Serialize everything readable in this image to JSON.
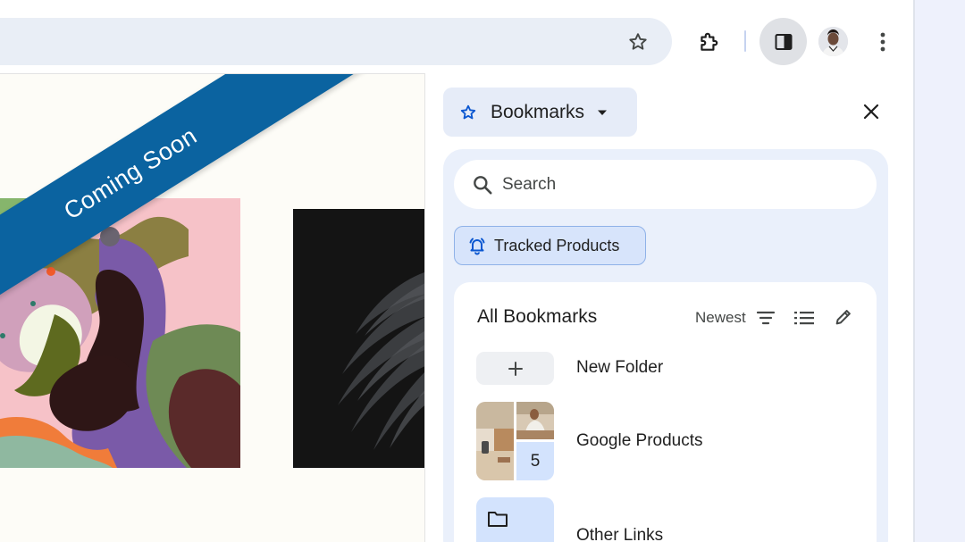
{
  "banner": {
    "text": "Coming Soon"
  },
  "toolbar": {
    "bookmark_star_icon": "star-outline-icon",
    "extensions_icon": "puzzle-icon",
    "side_panel_icon": "side-panel-icon",
    "menu_icon": "three-dots-vertical-icon"
  },
  "side_panel": {
    "header_title": "Bookmarks",
    "search": {
      "placeholder": "Search",
      "value": ""
    },
    "chip": {
      "label": "Tracked Products",
      "icon": "bell-ring-icon"
    },
    "section": {
      "title": "All Bookmarks",
      "sort_label": "Newest"
    },
    "items": [
      {
        "label": "New Folder",
        "type": "action"
      },
      {
        "label": "Google Products",
        "type": "folder",
        "count": "5"
      },
      {
        "label": "Other Links",
        "type": "folder"
      }
    ]
  },
  "colors": {
    "accent": "#0b57d0",
    "banner": "#0b63a0",
    "panel_bg": "#eaf0fb",
    "chip_bg": "#d7e4fb"
  }
}
